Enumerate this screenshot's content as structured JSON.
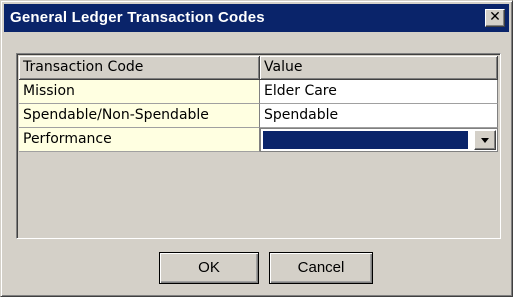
{
  "window": {
    "title": "General Ledger Transaction Codes",
    "close_label": "✕"
  },
  "grid": {
    "columns": [
      "Transaction Code",
      "Value"
    ],
    "rows": [
      {
        "code": "Mission",
        "value": "Elder Care"
      },
      {
        "code": "Spendable/Non-Spendable",
        "value": "Spendable"
      },
      {
        "code": "Performance",
        "value": ""
      }
    ]
  },
  "buttons": {
    "ok": "OK",
    "cancel": "Cancel"
  }
}
